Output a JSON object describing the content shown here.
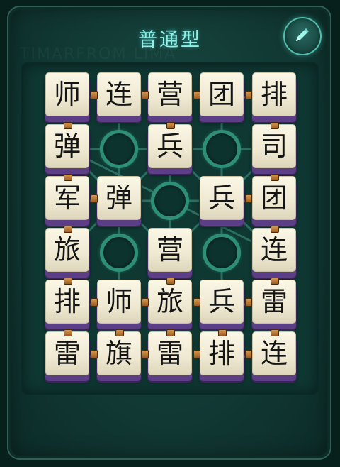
{
  "header": {
    "title": "普通型",
    "watermark": "TIMARFROM LIMA",
    "edit_icon": "pencil-icon"
  },
  "colors": {
    "title": "#8ef0e6",
    "panel": "#123a35",
    "board": "#0f3833",
    "piece_face": "#f5f0dc",
    "piece_base": "#5b3e86",
    "station_ring": "#2e8f77",
    "link": "#d79a4e"
  },
  "board": {
    "columns": 5,
    "rows": 6,
    "cells": [
      [
        "师",
        "连",
        "营",
        "团",
        "排"
      ],
      [
        "弹",
        "",
        "兵",
        "",
        "司"
      ],
      [
        "军",
        "弹",
        "",
        "兵",
        "团"
      ],
      [
        "旅",
        "",
        "营",
        "",
        "连"
      ],
      [
        "排",
        "师",
        "旅",
        "兵",
        "雷"
      ],
      [
        "雷",
        "旗",
        "雷",
        "排",
        "连"
      ]
    ],
    "camps": [
      [
        1,
        1
      ],
      [
        1,
        3
      ],
      [
        2,
        2
      ],
      [
        3,
        1
      ],
      [
        3,
        3
      ]
    ]
  }
}
